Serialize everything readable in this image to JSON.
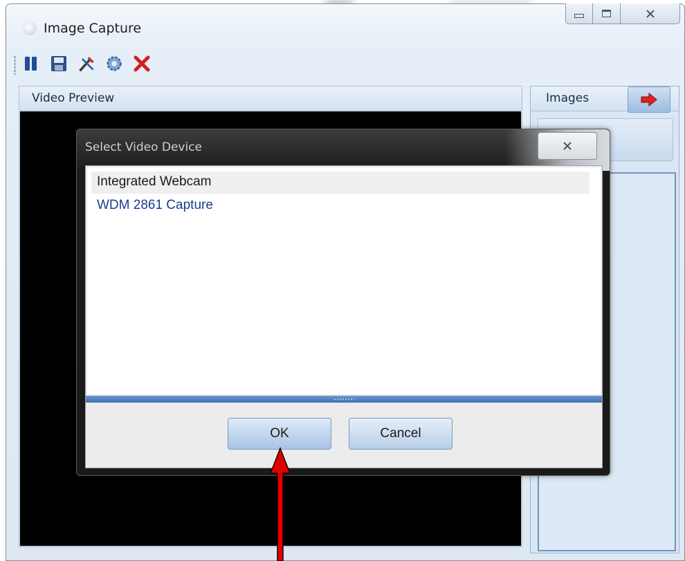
{
  "window": {
    "title": "Image Capture",
    "controls": {
      "minimize": "minimize",
      "maximize": "maximize",
      "close": "close"
    }
  },
  "toolbar": {
    "items": [
      {
        "name": "pause-icon",
        "color": "#1f4f9a"
      },
      {
        "name": "save-icon",
        "color": "#2e4f86"
      },
      {
        "name": "tools-icon",
        "color": "#c0392b"
      },
      {
        "name": "gear-icon",
        "color": "#3b6fa6"
      },
      {
        "name": "close-red-x-icon",
        "color": "#d21f1f"
      }
    ]
  },
  "preview": {
    "header": "Video Preview"
  },
  "images_panel": {
    "header": "Images",
    "arrow_icon": "right-arrow-icon",
    "arrow_color": "#e02020"
  },
  "dialog": {
    "title": "Select Video Device",
    "devices": [
      {
        "label": "Integrated Webcam",
        "selected": true
      },
      {
        "label": "WDM 2861 Capture",
        "selected": false
      }
    ],
    "ok_label": "OK",
    "cancel_label": "Cancel"
  },
  "annotation": {
    "arrow_color": "#e00000"
  }
}
